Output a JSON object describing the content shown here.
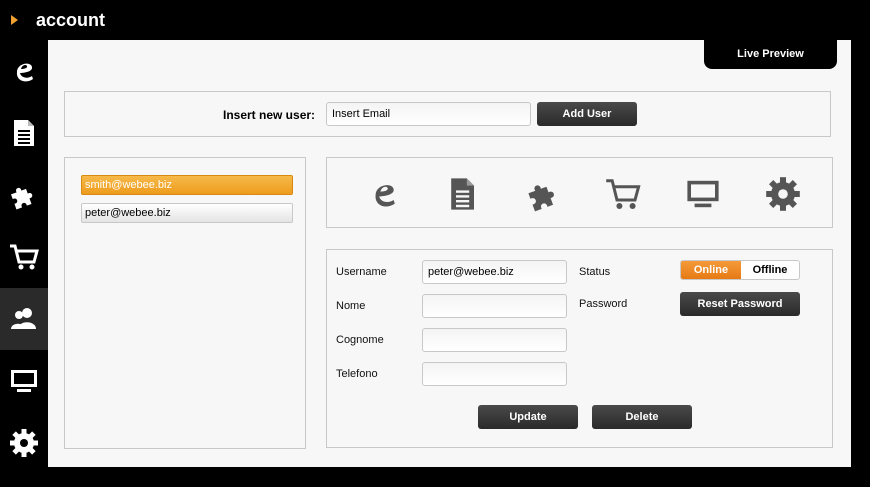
{
  "header": {
    "title": "account"
  },
  "sidebar": {
    "items": [
      {
        "icon": "webee-logo-icon"
      },
      {
        "icon": "document-icon"
      },
      {
        "icon": "puzzle-icon"
      },
      {
        "icon": "cart-icon"
      },
      {
        "icon": "users-icon",
        "active": true
      },
      {
        "icon": "monitor-icon"
      },
      {
        "icon": "gear-icon"
      }
    ]
  },
  "preview": {
    "label": "Live Preview"
  },
  "new_user": {
    "label": "Insert new user:",
    "email_value": "Insert Email",
    "button": "Add User"
  },
  "users": [
    {
      "email": "smith@webee.biz",
      "selected": true
    },
    {
      "email": "peter@webee.biz",
      "selected": false
    }
  ],
  "modules": [
    "webee-logo-icon",
    "document-icon",
    "puzzle-icon",
    "cart-icon",
    "monitor-icon",
    "gear-icon"
  ],
  "form": {
    "username_label": "Username",
    "username_value": "peter@webee.biz",
    "nome_label": "Nome",
    "nome_value": "",
    "cognome_label": "Cognome",
    "cognome_value": "",
    "telefono_label": "Telefono",
    "telefono_value": "",
    "status_label": "Status",
    "status_online": "Online",
    "status_offline": "Offline",
    "status_value": "Online",
    "password_label": "Password",
    "reset_button": "Reset Password",
    "update_button": "Update",
    "delete_button": "Delete"
  },
  "colors": {
    "accent": "#ee9c1c",
    "dark": "#2f2f2f",
    "icon": "#555555"
  }
}
